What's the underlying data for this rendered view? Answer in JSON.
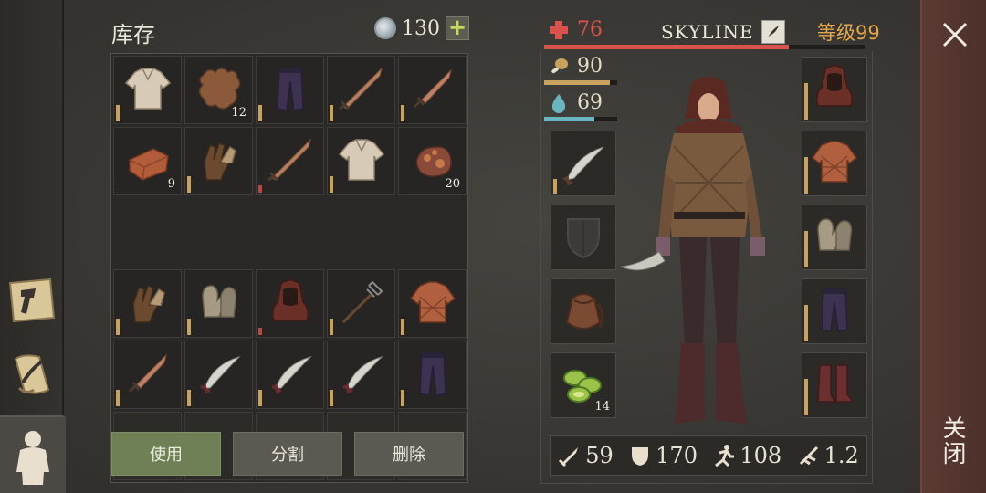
{
  "inventory": {
    "title": "库存",
    "coins": "130",
    "plus_label": "+",
    "rows": [
      [
        {
          "icon": "shirt-icon",
          "qty": "",
          "dura": "full"
        },
        {
          "icon": "leather-hide-icon",
          "qty": "12",
          "dura": "none"
        },
        {
          "icon": "pants-icon",
          "qty": "",
          "dura": "full"
        },
        {
          "icon": "sword-icon",
          "qty": "",
          "dura": "full"
        },
        {
          "icon": "dagger-icon",
          "qty": "",
          "dura": "full"
        }
      ],
      [
        {
          "icon": "copper-ingot-icon",
          "qty": "9",
          "dura": "none"
        },
        {
          "icon": "gloves-icon",
          "qty": "",
          "dura": "full"
        },
        {
          "icon": "sword-icon",
          "qty": "",
          "dura": "low"
        },
        {
          "icon": "shirt-icon",
          "qty": "",
          "dura": "full"
        },
        {
          "icon": "copper-ore-icon",
          "qty": "20",
          "dura": "none"
        }
      ],
      [
        {
          "icon": "gloves-icon",
          "qty": "",
          "dura": "full"
        },
        {
          "icon": "mittens-icon",
          "qty": "",
          "dura": "full"
        },
        {
          "icon": "hood-icon",
          "qty": "",
          "dura": "low"
        },
        {
          "icon": "pitchfork-icon",
          "qty": "",
          "dura": "full"
        },
        {
          "icon": "gambeson-icon",
          "qty": "",
          "dura": "full"
        }
      ],
      [
        {
          "icon": "dagger-icon",
          "qty": "",
          "dura": "full"
        },
        {
          "icon": "scimitar-icon",
          "qty": "",
          "dura": "full"
        },
        {
          "icon": "scimitar-icon",
          "qty": "",
          "dura": "full"
        },
        {
          "icon": "scimitar-icon",
          "qty": "",
          "dura": "full"
        },
        {
          "icon": "pants-icon",
          "qty": "",
          "dura": "full"
        }
      ],
      [
        {
          "icon": "",
          "qty": "",
          "dura": "none"
        },
        {
          "icon": "",
          "qty": "",
          "dura": "none"
        },
        {
          "icon": "",
          "qty": "",
          "dura": "none"
        },
        {
          "icon": "",
          "qty": "",
          "dura": "none"
        },
        {
          "icon": "",
          "qty": "",
          "dura": "none"
        }
      ]
    ],
    "actions": {
      "use": "使用",
      "split": "分割",
      "delete": "删除"
    }
  },
  "character": {
    "name": "SKYLINE",
    "level": "等级99",
    "health": "76",
    "food": "90",
    "water": "69",
    "health_fraction": 0.76,
    "food_fraction": 0.9,
    "water_fraction": 0.69,
    "weapon_slot": {
      "icon": "scimitar-icon"
    },
    "shield_slot": {
      "icon": "shield-icon"
    },
    "bag_slot": {
      "icon": "pouch-icon"
    },
    "food_slot": {
      "icon": "cucumber-slices-icon",
      "qty": "14"
    },
    "armor_slots": [
      "hood-icon",
      "gambeson-icon",
      "mittens-icon",
      "pants-icon",
      "boots-icon"
    ],
    "stats": {
      "attack": "59",
      "defense": "170",
      "speed": "108",
      "weight": "1.2"
    }
  },
  "colors": {
    "health": "#d9534a",
    "food": "#c8a25e",
    "water": "#6ab6c0",
    "level": "#e2a74c",
    "close_rail": "#5b3a33"
  },
  "close_label": "关闭"
}
